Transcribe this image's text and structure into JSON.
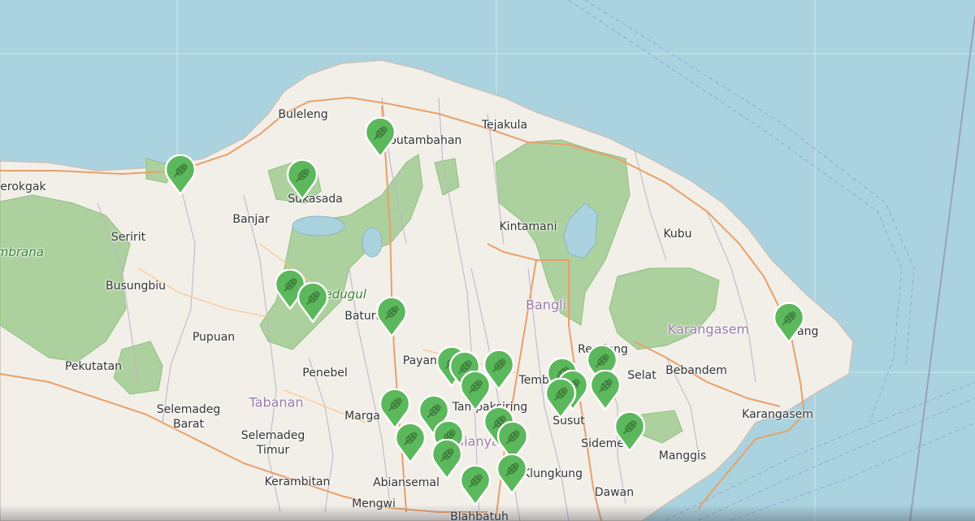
{
  "map": {
    "labels": {
      "buleleng": "Buleleng",
      "sukasada": "Sukasada",
      "kubutambahan": "Kubutambahan",
      "tejakula": "Tejakula",
      "serokgak": "Serokgak",
      "banjar": "Banjar",
      "seririt": "Seririt",
      "busungbiu": "Busungbiu",
      "pupuan": "Pupuan",
      "pekutatan": "Pekutatan",
      "penebel": "Penebel",
      "tabanan": "Tabanan",
      "selemadeg_barat": "Selemadeg\nBarat",
      "selemadeg_timur": "Selemadeg\nTimur",
      "kerambitan": "Kerambitan",
      "marga": "Marga",
      "abiansemal": "Abiansemal",
      "mengwi": "Mengwi",
      "blahbatuh": "Blahbatuh",
      "baturiti": "Baturiti",
      "payangan": "Payangan",
      "tampaksiring": "Tampaksiring",
      "gianyar": "Gianyar",
      "kintamani": "Kintamani",
      "bangli": "Bangli",
      "tembuku": "Tembuku",
      "susut": "Susut",
      "rendang": "Rendang",
      "selat": "Selat",
      "bebandem": "Bebandem",
      "kubu": "Kubu",
      "karangasem_region": "Karangasem",
      "karangasem_town": "Karangasem",
      "abang": "Abang",
      "sidemen": "Sidemen",
      "manggis": "Manggis",
      "klungkung": "Klungkung",
      "dawan": "Dawan",
      "bedugul": "Bedugul",
      "jembrana_park": "Jembrana"
    },
    "marker_icon": "leaf-icon",
    "marker_color": "#5cb85c",
    "marker_count": 33
  }
}
